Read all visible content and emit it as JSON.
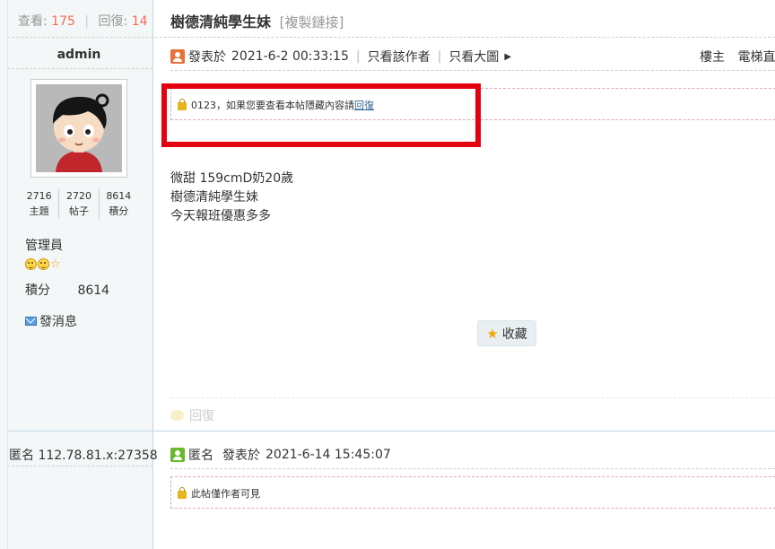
{
  "sidebar": {
    "views_label": "查看:",
    "views": "175",
    "replies_label": "回復:",
    "replies": "14",
    "username": "admin",
    "counts": [
      {
        "value": "2716",
        "label": "主題"
      },
      {
        "value": "2720",
        "label": "帖子"
      },
      {
        "value": "8614",
        "label": "積分"
      }
    ],
    "role": "管理員",
    "credits_label": "積分",
    "credits_value": "8614",
    "send_message": "發消息",
    "anon_ip": "匿名 112.78.81.x:27358"
  },
  "thread": {
    "title": "樹德清純學生妹",
    "copy_link": "[複製鏈接]"
  },
  "post1": {
    "posted_prefix": "發表於",
    "posted_time": "2021-6-2 00:33:15",
    "only_author": "只看該作者",
    "only_images": "只看大圖",
    "floor": "樓主",
    "floor_extra": "電梯直",
    "hidden_text": "0123，如果您要查看本帖隱藏內容請",
    "hidden_link": "回復",
    "content": [
      "微甜 159cmD奶20歲",
      "樹德清純學生妹",
      "今天報班優惠多多"
    ],
    "favorite": "收藏",
    "reply": "回復"
  },
  "post2": {
    "author": "匿名",
    "posted_prefix": "發表於",
    "posted_time": "2021-6-14 15:45:07",
    "hidden_text": "此帖僅作者可見"
  },
  "colors": {
    "highlight_box": "#e3000f",
    "stat_number": "#f26c4f",
    "link": "#336699"
  }
}
